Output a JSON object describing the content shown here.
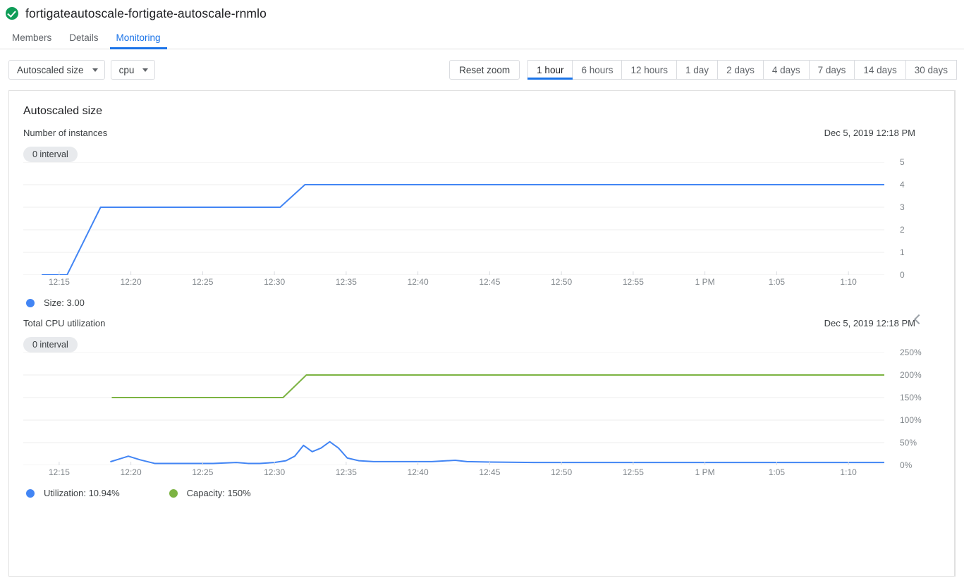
{
  "header": {
    "status_icon": "check-circle-icon",
    "status_color": "#0f9d58",
    "title": "fortigateautoscale-fortigate-autoscale-rnmlo"
  },
  "tabs": [
    {
      "label": "Members",
      "active": false
    },
    {
      "label": "Details",
      "active": false
    },
    {
      "label": "Monitoring",
      "active": true
    }
  ],
  "toolbar": {
    "metric_select": {
      "value": "Autoscaled size",
      "icon": "chevron-down-icon"
    },
    "resource_select": {
      "value": "cpu",
      "icon": "chevron-down-icon"
    },
    "reset_zoom_label": "Reset zoom",
    "ranges": [
      {
        "label": "1 hour",
        "active": true
      },
      {
        "label": "6 hours",
        "active": false
      },
      {
        "label": "12 hours",
        "active": false
      },
      {
        "label": "1 day",
        "active": false
      },
      {
        "label": "2 days",
        "active": false
      },
      {
        "label": "4 days",
        "active": false
      },
      {
        "label": "7 days",
        "active": false
      },
      {
        "label": "14 days",
        "active": false
      },
      {
        "label": "30 days",
        "active": false
      }
    ]
  },
  "card": {
    "title": "Autoscaled size",
    "collapse_icon": "chevron-left-icon"
  },
  "colors": {
    "blue": "#4285f4",
    "green": "#7cb342",
    "grid": "#ececec",
    "accent": "#1a73e8"
  },
  "chart_data": [
    {
      "id": "autoscaled-size",
      "type": "line",
      "title": "Autoscaled size",
      "subtitle": "Number of instances",
      "timestamp": "Dec 5, 2019 12:18 PM",
      "interval_badge": "0 interval",
      "xlabel": "",
      "ylabel": "Number of instances",
      "ylim": [
        0,
        5
      ],
      "yticks": [
        0,
        1,
        2,
        3,
        4,
        5
      ],
      "ytick_labels": [
        "0",
        "1",
        "2",
        "3",
        "4",
        "5"
      ],
      "xtick_labels": [
        "12:15",
        "12:20",
        "12:25",
        "12:30",
        "12:35",
        "12:40",
        "12:45",
        "12:50",
        "12:55",
        "1 PM",
        "1:05",
        "1:10"
      ],
      "xlim_minutes": [
        13.0,
        72.0
      ],
      "grid": true,
      "legend_position": "bottom",
      "series": [
        {
          "name": "Size",
          "legend": "Size: 3.00",
          "color": "#4285f4",
          "x": [
            14.3,
            16.0,
            18.3,
            30.6,
            32.3,
            72.0
          ],
          "y": [
            0,
            0,
            3,
            3,
            4,
            4
          ]
        }
      ]
    },
    {
      "id": "total-cpu-utilization",
      "type": "line",
      "title": "Total CPU utilization",
      "subtitle": "",
      "timestamp": "Dec 5, 2019 12:18 PM",
      "interval_badge": "0 interval",
      "xlabel": "",
      "ylabel": "",
      "ylim": [
        0,
        250
      ],
      "yticks": [
        0,
        50,
        100,
        150,
        200,
        250
      ],
      "ytick_labels": [
        "0%",
        "50%",
        "100%",
        "150%",
        "200%",
        "250%"
      ],
      "xtick_labels": [
        "12:15",
        "12:20",
        "12:25",
        "12:30",
        "12:35",
        "12:40",
        "12:45",
        "12:50",
        "12:55",
        "1 PM",
        "1:05",
        "1:10"
      ],
      "xlim_minutes": [
        13.0,
        72.0
      ],
      "grid": true,
      "legend_position": "bottom",
      "series": [
        {
          "name": "Capacity",
          "legend": "Capacity: 150%",
          "color": "#7cb342",
          "x": [
            19.1,
            30.8,
            32.4,
            72.0
          ],
          "y": [
            150,
            150,
            200,
            200
          ]
        },
        {
          "name": "Utilization",
          "legend": "Utilization: 10.94%",
          "color": "#4285f4",
          "x": [
            19.0,
            19.6,
            20.2,
            21.0,
            22.0,
            24.0,
            26.0,
            27.6,
            28.4,
            29.2,
            30.2,
            31.0,
            31.6,
            32.2,
            32.8,
            33.4,
            34.0,
            34.6,
            35.2,
            36.0,
            37.0,
            39.0,
            41.0,
            42.6,
            43.4,
            45.0,
            48.0,
            52.0,
            56.0,
            60.0,
            64.0,
            68.0,
            72.0
          ],
          "y": [
            8,
            14,
            20,
            12,
            4,
            4,
            4,
            6,
            4,
            4,
            6,
            10,
            20,
            44,
            30,
            38,
            52,
            38,
            16,
            10,
            8,
            8,
            8,
            11,
            8,
            7,
            6,
            6,
            6,
            6,
            6,
            6,
            6
          ]
        }
      ]
    }
  ]
}
